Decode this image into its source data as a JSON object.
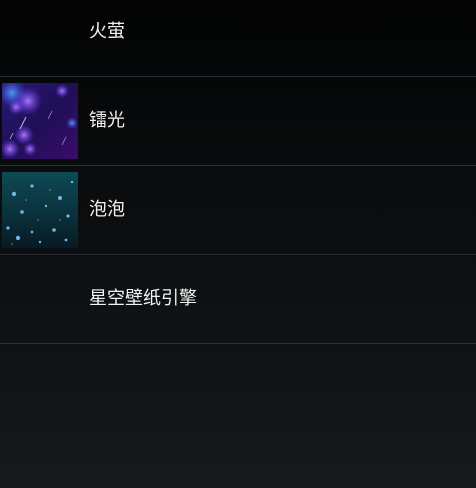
{
  "wallpapers": [
    {
      "label": "火萤",
      "icon": "none"
    },
    {
      "label": "镭光",
      "icon": "laser-thumbnail-icon"
    },
    {
      "label": "泡泡",
      "icon": "bubbles-thumbnail-icon"
    },
    {
      "label": "星空壁纸引擎",
      "icon": "none"
    }
  ],
  "colors": {
    "background_top": "#030404",
    "background_bottom": "#161a1d",
    "divider": "#2b2f33",
    "text": "#f2f2f2"
  }
}
